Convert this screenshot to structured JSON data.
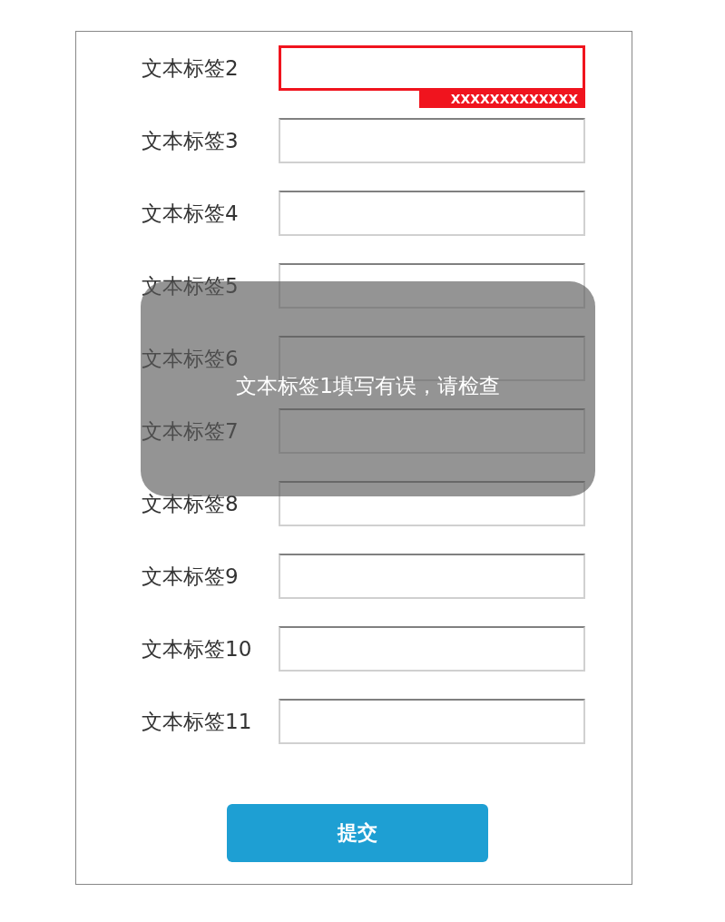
{
  "form": {
    "fields": [
      {
        "label": "文本标签2",
        "invalid": true,
        "error": "XXXXXXXXXXXXX"
      },
      {
        "label": "文本标签3",
        "invalid": false
      },
      {
        "label": "文本标签4",
        "invalid": false
      },
      {
        "label": "文本标签5",
        "invalid": false
      },
      {
        "label": "文本标签6",
        "invalid": false
      },
      {
        "label": "文本标签7",
        "invalid": false
      },
      {
        "label": "文本标签8",
        "invalid": false
      },
      {
        "label": "文本标签9",
        "invalid": false
      },
      {
        "label": "文本标签10",
        "invalid": false
      },
      {
        "label": "文本标签11",
        "invalid": false
      }
    ],
    "submit": "提交"
  },
  "toast": {
    "message": "文本标签1填写有误，请检查"
  }
}
